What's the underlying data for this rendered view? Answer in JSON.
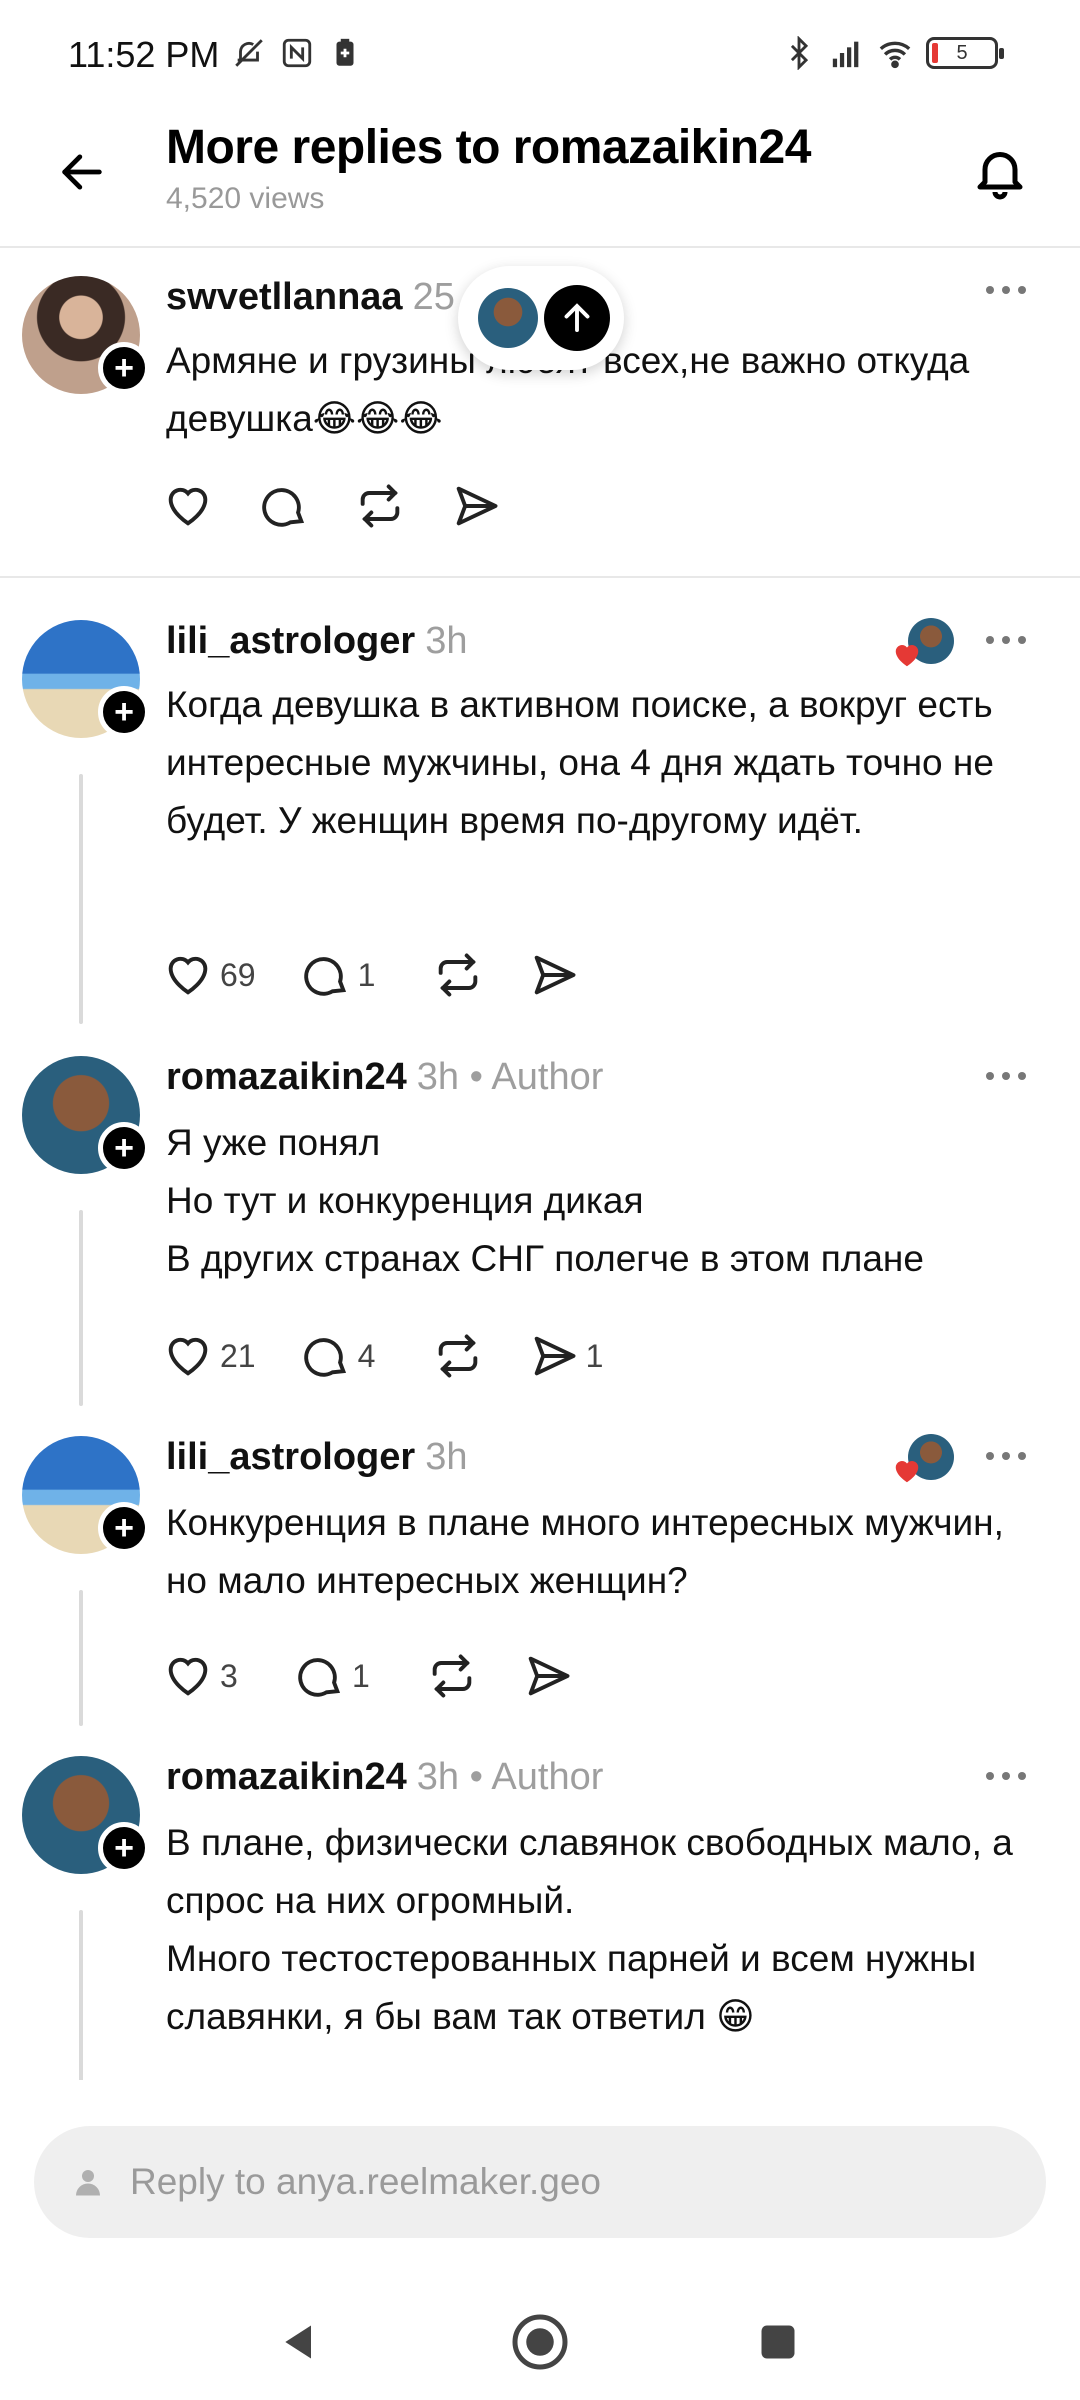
{
  "status_bar": {
    "time": "11:52 PM",
    "battery_level": "5",
    "left_icons": [
      "mute-icon",
      "nfc-icon",
      "battery-saver-icon"
    ],
    "right_icons": [
      "bluetooth-icon",
      "signal-icon",
      "wifi-icon",
      "battery-icon"
    ]
  },
  "header": {
    "title": "More replies to romazaikin24",
    "views": "4,520 views"
  },
  "posts": [
    {
      "username": "swvetllannaa",
      "time": "25",
      "text": "Армяне и грузины любят всех,не важно откуда девушка😂😂😂",
      "likes": "",
      "replies": "",
      "shares": ""
    },
    {
      "username": "lili_astrologer",
      "time": "3h",
      "text": "Когда девушка в активном поиске, а вокруг есть интересные мужчины, она 4 дня ждать точно не будет. У женщин время по-другому идёт.",
      "likes": "69",
      "replies": "1",
      "shares": ""
    },
    {
      "username": "romazaikin24",
      "time": "3h",
      "author_label": "• Author",
      "text": "Я уже понял\nНо тут и конкуренция дикая\nВ других странах СНГ полегче в этом плане",
      "likes": "21",
      "replies": "4",
      "shares": "1"
    },
    {
      "username": "lili_astrologer",
      "time": "3h",
      "text": "Конкуренция в плане много интересных мужчин, но мало интересных женщин?",
      "likes": "3",
      "replies": "1",
      "shares": ""
    },
    {
      "username": "romazaikin24",
      "time": "3h",
      "author_label": "• Author",
      "text": "В плане, физически славянок свободных мало, а спрос на них огромный.\nМного тестостерованных парней и всем нужны славянки, я бы вам так ответил 😁",
      "likes": "",
      "replies": "",
      "shares": ""
    }
  ],
  "reply_bar": {
    "placeholder": "Reply to anya.reelmaker.geo"
  },
  "colors": {
    "accent": "#000000",
    "muted_text": "#9e9e9e",
    "heart": "#e53935",
    "divider": "#e8e8e8"
  }
}
